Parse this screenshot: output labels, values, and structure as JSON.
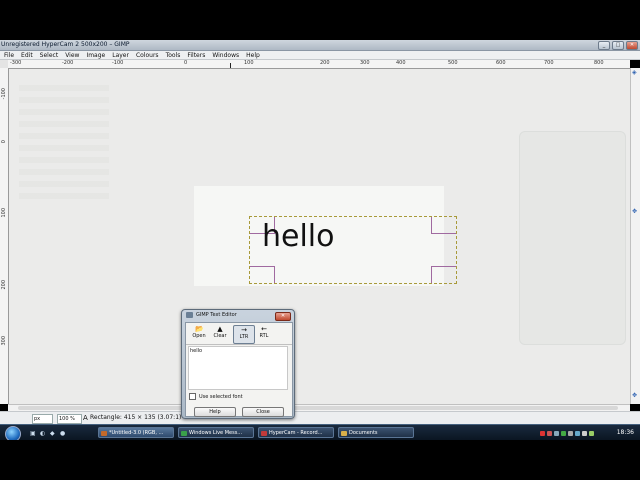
{
  "window": {
    "title": "Unregistered HyperCam 2",
    "subtitle": "500x200 – GIMP",
    "minimize": "_",
    "maximize": "□",
    "close": "✕"
  },
  "menu": [
    "File",
    "Edit",
    "Select",
    "View",
    "Image",
    "Layer",
    "Colours",
    "Tools",
    "Filters",
    "Windows",
    "Help"
  ],
  "ruler": {
    "h": [
      "-300",
      "-200",
      "-100",
      "0",
      "100",
      "200",
      "300",
      "400",
      "500",
      "600",
      "700",
      "800"
    ],
    "v": [
      "-100",
      "0",
      "100",
      "200",
      "300"
    ]
  },
  "canvas": {
    "text": "hello"
  },
  "text_editor": {
    "title": "GIMP Text Editor",
    "close": "✕",
    "tools": [
      {
        "label": "Open",
        "icon": "📂"
      },
      {
        "label": "Clear",
        "icon": "▲"
      },
      {
        "label": "LTR",
        "icon": "→"
      },
      {
        "label": "RTL",
        "icon": "←"
      }
    ],
    "content": "hello",
    "checkbox_label": "Use selected font",
    "help_label": "Help",
    "close_label": "Close"
  },
  "status": {
    "unit": "px",
    "zoom": "100 %",
    "message": "Rectangle: 415 × 135  (3.07:1)"
  },
  "taskbar": {
    "tasks": [
      {
        "label": "*Untitled-3.0 (RGB, ...",
        "color": "#c46a2a"
      },
      {
        "label": "Windows Live Mess...",
        "color": "#3aa04a"
      },
      {
        "label": "HyperCam - Record...",
        "color": "#c23a3a"
      },
      {
        "label": "Documents",
        "color": "#d9b04a"
      }
    ],
    "clock": "18:36"
  }
}
